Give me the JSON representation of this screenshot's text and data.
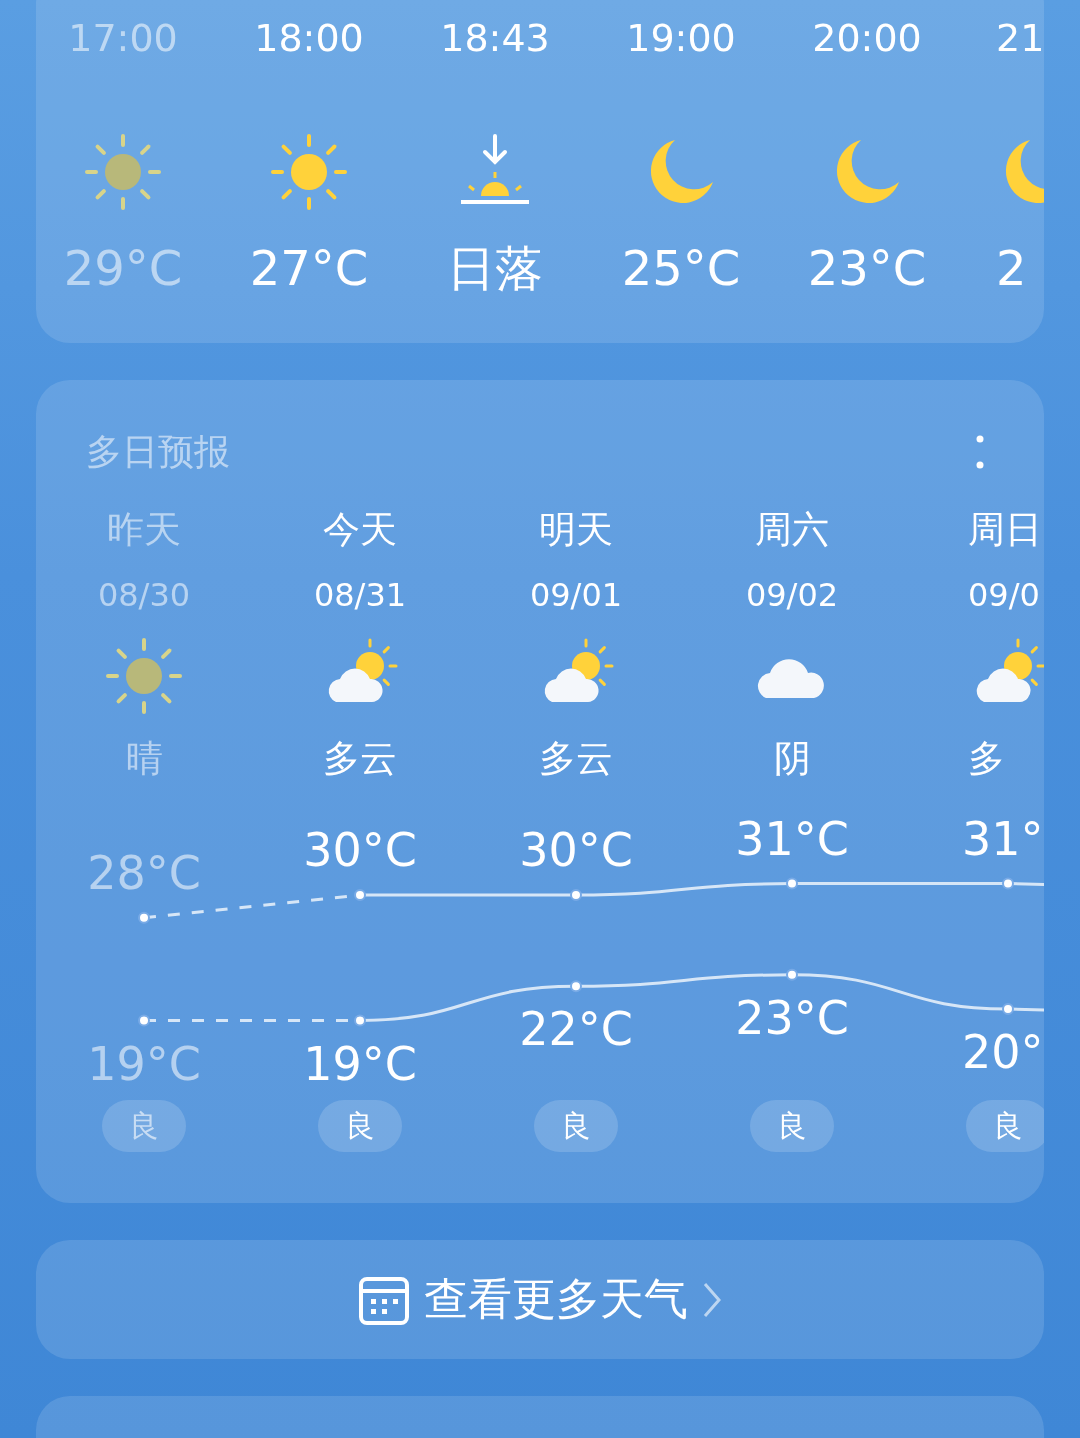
{
  "hourly": [
    {
      "time": "17:00",
      "kind": "sun",
      "label": "29°C",
      "past": true
    },
    {
      "time": "18:00",
      "kind": "sun",
      "label": "27°C",
      "past": false
    },
    {
      "time": "18:43",
      "kind": "sunset",
      "label": "日落",
      "past": false
    },
    {
      "time": "19:00",
      "kind": "moon",
      "label": "25°C",
      "past": false
    },
    {
      "time": "20:00",
      "kind": "moon",
      "label": "23°C",
      "past": false
    },
    {
      "time": "21",
      "kind": "moon",
      "label": "2",
      "past": false
    }
  ],
  "forecast": {
    "title": "多日预报",
    "days": [
      {
        "name": "昨天",
        "date": "08/30",
        "kind": "sun",
        "condition": "晴",
        "high": "28°C",
        "low": "19°C",
        "aqi": "良",
        "past": true
      },
      {
        "name": "今天",
        "date": "08/31",
        "kind": "partly",
        "condition": "多云",
        "high": "30°C",
        "low": "19°C",
        "aqi": "良",
        "past": false
      },
      {
        "name": "明天",
        "date": "09/01",
        "kind": "partly",
        "condition": "多云",
        "high": "30°C",
        "low": "22°C",
        "aqi": "良",
        "past": false
      },
      {
        "name": "周六",
        "date": "09/02",
        "kind": "cloud",
        "condition": "阴",
        "high": "31°C",
        "low": "23°C",
        "aqi": "良",
        "past": false
      },
      {
        "name": "周日",
        "date": "09/0",
        "kind": "partly",
        "condition": "多",
        "high": "31°",
        "low": "20°",
        "aqi": "良",
        "past": false
      }
    ]
  },
  "more_button": {
    "label": "查看更多天气"
  }
}
